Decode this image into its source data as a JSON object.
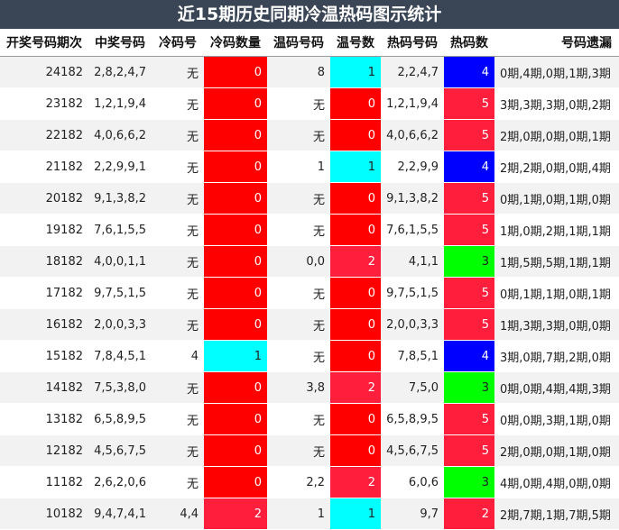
{
  "title": "近15期历史同期冷温热码图示统计",
  "headers": [
    "开奖号码期次",
    "中奖号码",
    "冷码号",
    "冷码数量",
    "温码号码",
    "温号数",
    "热码号码",
    "热码数",
    "号码遗漏"
  ],
  "colors": {
    "cold": "#ff0000",
    "cyan": "#00ffff",
    "warm_red": "#ff0000",
    "warm_pink": "#ff1e3c",
    "hot_blue": "#0000ff",
    "hot_red": "#ff1e3c",
    "hot_green": "#00ff00"
  },
  "rows": [
    {
      "issue": "24182",
      "numbers": "2,8,2,4,7",
      "cold": "无",
      "cold_count": "0",
      "cold_color": "#ff0000",
      "warm": "8",
      "warm_count": "1",
      "warm_color": "#00ffff",
      "hot": "2,2,4,7",
      "hot_count": "4",
      "hot_color": "#0000ff",
      "omit": "0期,4期,0期,1期,3期"
    },
    {
      "issue": "23182",
      "numbers": "1,2,1,9,4",
      "cold": "无",
      "cold_count": "0",
      "cold_color": "#ff0000",
      "warm": "无",
      "warm_count": "0",
      "warm_color": "#ff0000",
      "hot": "1,2,1,9,4",
      "hot_count": "5",
      "hot_color": "#ff1e3c",
      "omit": "3期,3期,3期,0期,2期"
    },
    {
      "issue": "22182",
      "numbers": "4,0,6,6,2",
      "cold": "无",
      "cold_count": "0",
      "cold_color": "#ff0000",
      "warm": "无",
      "warm_count": "0",
      "warm_color": "#ff0000",
      "hot": "4,0,6,6,2",
      "hot_count": "5",
      "hot_color": "#ff1e3c",
      "omit": "2期,0期,0期,0期,1期"
    },
    {
      "issue": "21182",
      "numbers": "2,2,9,9,1",
      "cold": "无",
      "cold_count": "0",
      "cold_color": "#ff0000",
      "warm": "1",
      "warm_count": "1",
      "warm_color": "#00ffff",
      "hot": "2,2,9,9",
      "hot_count": "4",
      "hot_color": "#0000ff",
      "omit": "2期,2期,0期,0期,4期"
    },
    {
      "issue": "20182",
      "numbers": "9,1,3,8,2",
      "cold": "无",
      "cold_count": "0",
      "cold_color": "#ff0000",
      "warm": "无",
      "warm_count": "0",
      "warm_color": "#ff0000",
      "hot": "9,1,3,8,2",
      "hot_count": "5",
      "hot_color": "#ff1e3c",
      "omit": "0期,1期,0期,1期,0期"
    },
    {
      "issue": "19182",
      "numbers": "7,6,1,5,5",
      "cold": "无",
      "cold_count": "0",
      "cold_color": "#ff0000",
      "warm": "无",
      "warm_count": "0",
      "warm_color": "#ff0000",
      "hot": "7,6,1,5,5",
      "hot_count": "5",
      "hot_color": "#ff1e3c",
      "omit": "1期,0期,2期,1期,1期"
    },
    {
      "issue": "18182",
      "numbers": "4,0,0,1,1",
      "cold": "无",
      "cold_count": "0",
      "cold_color": "#ff0000",
      "warm": "0,0",
      "warm_count": "2",
      "warm_color": "#ff1e3c",
      "hot": "4,1,1",
      "hot_count": "3",
      "hot_color": "#00ff00",
      "omit": "1期,5期,5期,1期,1期"
    },
    {
      "issue": "17182",
      "numbers": "9,7,5,1,5",
      "cold": "无",
      "cold_count": "0",
      "cold_color": "#ff0000",
      "warm": "无",
      "warm_count": "0",
      "warm_color": "#ff0000",
      "hot": "9,7,5,1,5",
      "hot_count": "5",
      "hot_color": "#ff1e3c",
      "omit": "0期,1期,1期,0期,1期"
    },
    {
      "issue": "16182",
      "numbers": "2,0,0,3,3",
      "cold": "无",
      "cold_count": "0",
      "cold_color": "#ff0000",
      "warm": "无",
      "warm_count": "0",
      "warm_color": "#ff0000",
      "hot": "2,0,0,3,3",
      "hot_count": "5",
      "hot_color": "#ff1e3c",
      "omit": "1期,3期,3期,0期,0期"
    },
    {
      "issue": "15182",
      "numbers": "7,8,4,5,1",
      "cold": "4",
      "cold_count": "1",
      "cold_color": "#00ffff",
      "warm": "无",
      "warm_count": "0",
      "warm_color": "#ff0000",
      "hot": "7,8,5,1",
      "hot_count": "4",
      "hot_color": "#0000ff",
      "omit": "3期,0期,7期,2期,0期"
    },
    {
      "issue": "14182",
      "numbers": "7,5,3,8,0",
      "cold": "无",
      "cold_count": "0",
      "cold_color": "#ff0000",
      "warm": "3,8",
      "warm_count": "2",
      "warm_color": "#ff1e3c",
      "hot": "7,5,0",
      "hot_count": "3",
      "hot_color": "#00ff00",
      "omit": "0期,0期,4期,4期,3期"
    },
    {
      "issue": "13182",
      "numbers": "6,5,8,9,5",
      "cold": "无",
      "cold_count": "0",
      "cold_color": "#ff0000",
      "warm": "无",
      "warm_count": "0",
      "warm_color": "#ff0000",
      "hot": "6,5,8,9,5",
      "hot_count": "5",
      "hot_color": "#ff1e3c",
      "omit": "0期,0期,3期,1期,0期"
    },
    {
      "issue": "12182",
      "numbers": "4,5,6,7,5",
      "cold": "无",
      "cold_count": "0",
      "cold_color": "#ff0000",
      "warm": "无",
      "warm_count": "0",
      "warm_color": "#ff0000",
      "hot": "4,5,6,7,5",
      "hot_count": "5",
      "hot_color": "#ff1e3c",
      "omit": "2期,0期,0期,1期,0期"
    },
    {
      "issue": "11182",
      "numbers": "2,6,2,0,6",
      "cold": "无",
      "cold_count": "0",
      "cold_color": "#ff0000",
      "warm": "2,2",
      "warm_count": "2",
      "warm_color": "#ff1e3c",
      "hot": "6,0,6",
      "hot_count": "3",
      "hot_color": "#00ff00",
      "omit": "4期,0期,4期,0期,0期"
    },
    {
      "issue": "10182",
      "numbers": "9,4,7,4,1",
      "cold": "4,4",
      "cold_count": "2",
      "cold_color": "#ff1e3c",
      "warm": "1",
      "warm_count": "1",
      "warm_color": "#00ffff",
      "hot": "9,7",
      "hot_count": "2",
      "hot_color": "#ff1e3c",
      "omit": "2期,7期,1期,7期,5期"
    }
  ]
}
